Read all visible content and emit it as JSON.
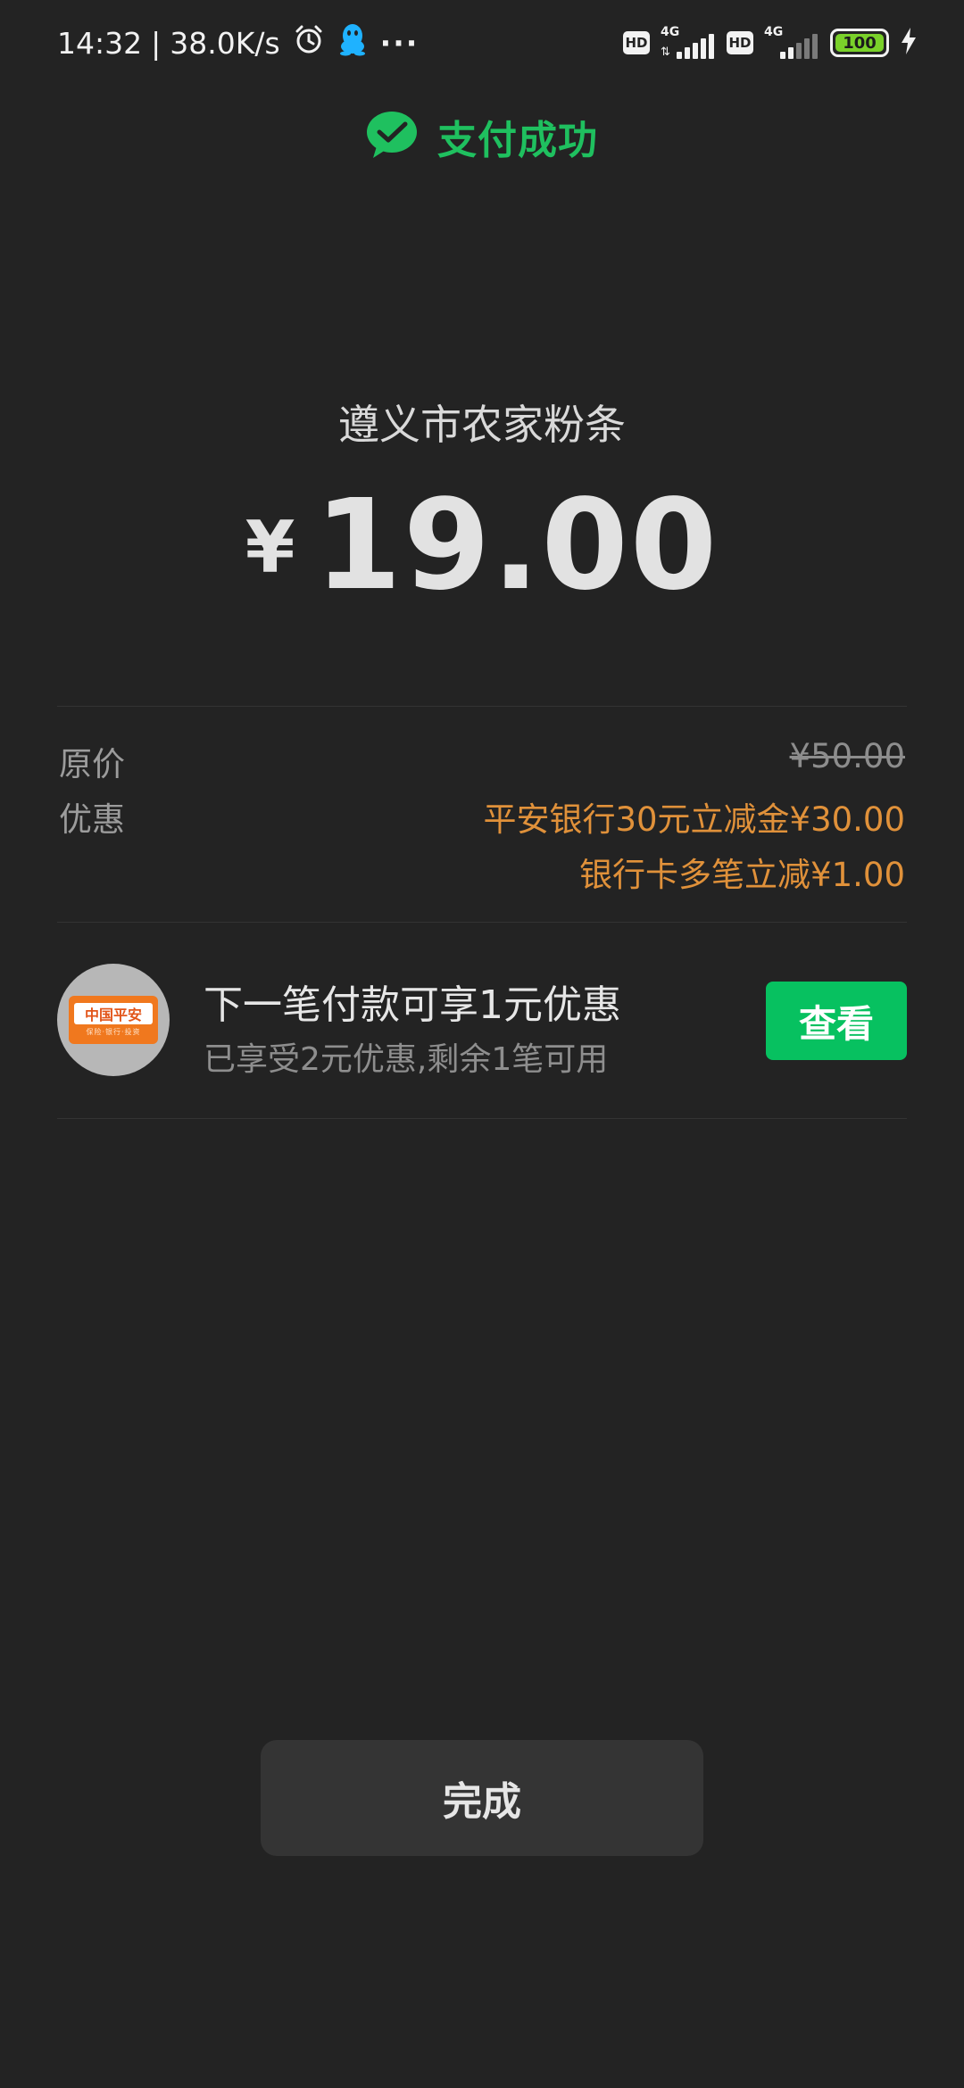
{
  "status_bar": {
    "time": "14:32",
    "separator": "|",
    "net_speed": "38.0K/s",
    "more": "···",
    "hd_label": "HD",
    "net_type": "4G",
    "battery": "100"
  },
  "header": {
    "title": "支付成功",
    "accent_color": "#1fc05f"
  },
  "payment": {
    "merchant": "遵义市农家粉条",
    "currency_symbol": "¥",
    "amount": "19.00"
  },
  "details": {
    "original_label": "原价",
    "original_value": "¥50.00",
    "discount_label": "优惠",
    "discounts": [
      "平安银行30元立减金¥30.00",
      "银行卡多笔立减¥1.00"
    ],
    "discount_color": "#e0913a"
  },
  "promo": {
    "logo_text": "中国平安",
    "logo_subtext": "保险·银行·投资",
    "title": "下一笔付款可享1元优惠",
    "subtitle": "已享受2元优惠,剩余1笔可用",
    "button_label": "查看",
    "button_color": "#07c160"
  },
  "footer": {
    "done_label": "完成"
  }
}
